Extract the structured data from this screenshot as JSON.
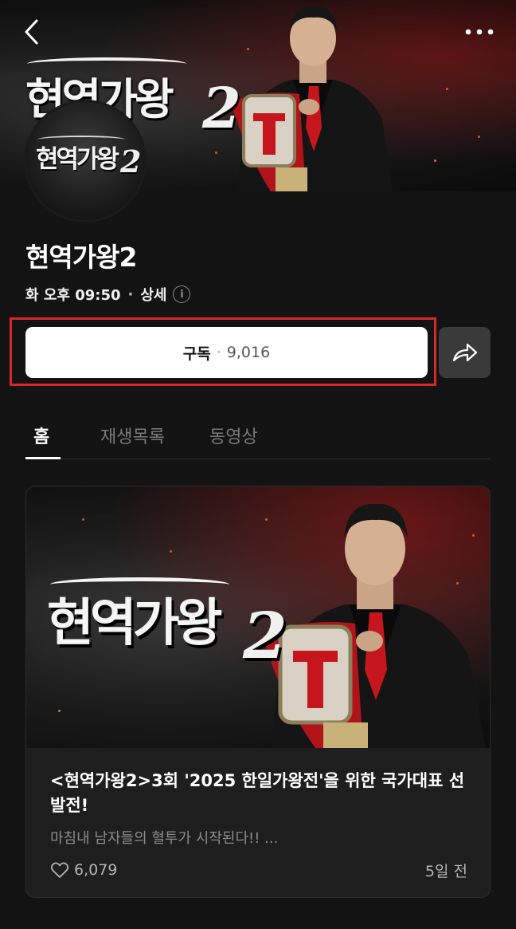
{
  "nav": {
    "back_icon": "chevron-left-icon",
    "more_icon": "more-horizontal-icon"
  },
  "banner": {
    "logo_text": "현역가왕",
    "logo_number": "2"
  },
  "channel": {
    "title": "현역가왕2",
    "schedule": "화 오후 09:50",
    "detail_label": "상세",
    "info_icon": "info-icon"
  },
  "subscribe": {
    "label": "구독",
    "separator": "·",
    "count": "9,016"
  },
  "share": {
    "icon": "share-arrow-icon"
  },
  "tabs": [
    {
      "label": "홈",
      "active": true
    },
    {
      "label": "재생목록",
      "active": false
    },
    {
      "label": "동영상",
      "active": false
    }
  ],
  "video": {
    "thumb_logo_text": "현역가왕",
    "thumb_logo_number": "2",
    "title": "<현역가왕2>3회 '2025 한일가왕전'을 위한 국가대표 선발전!",
    "description": "마침내 남자들의 혈투가 시작된다!! ...",
    "likes": "6,079",
    "age": "5일 전"
  },
  "colors": {
    "background": "#131313",
    "highlight": "#d8262c",
    "button": "#ffffff",
    "share_button": "#3a3a3a"
  }
}
